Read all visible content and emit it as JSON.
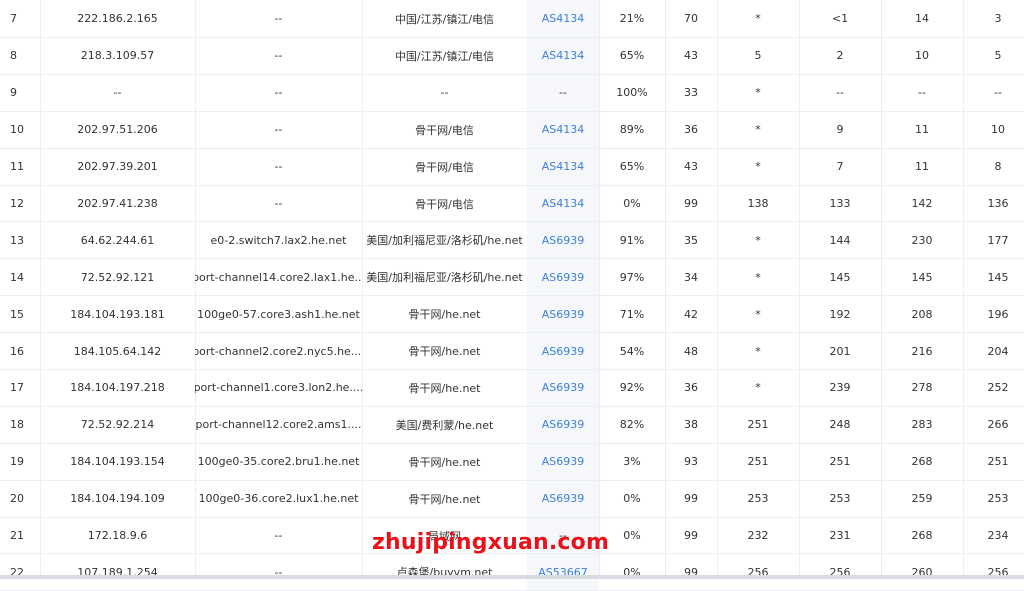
{
  "trace": {
    "rows": [
      {
        "hop": "7",
        "ip": "222.186.2.165",
        "host": "--",
        "location": "中国/江苏/镇江/电信",
        "as": "AS4134",
        "loss": "21%",
        "sent": "70",
        "last": "*",
        "avg": "<1",
        "best": "14",
        "worst": "3"
      },
      {
        "hop": "8",
        "ip": "218.3.109.57",
        "host": "--",
        "location": "中国/江苏/镇江/电信",
        "as": "AS4134",
        "loss": "65%",
        "sent": "43",
        "last": "5",
        "avg": "2",
        "best": "10",
        "worst": "5"
      },
      {
        "hop": "9",
        "ip": "--",
        "host": "--",
        "location": "--",
        "as": "--",
        "loss": "100%",
        "sent": "33",
        "last": "*",
        "avg": "--",
        "best": "--",
        "worst": "--"
      },
      {
        "hop": "10",
        "ip": "202.97.51.206",
        "host": "--",
        "location": "骨干网/电信",
        "as": "AS4134",
        "loss": "89%",
        "sent": "36",
        "last": "*",
        "avg": "9",
        "best": "11",
        "worst": "10"
      },
      {
        "hop": "11",
        "ip": "202.97.39.201",
        "host": "--",
        "location": "骨干网/电信",
        "as": "AS4134",
        "loss": "65%",
        "sent": "43",
        "last": "*",
        "avg": "7",
        "best": "11",
        "worst": "8"
      },
      {
        "hop": "12",
        "ip": "202.97.41.238",
        "host": "--",
        "location": "骨干网/电信",
        "as": "AS4134",
        "loss": "0%",
        "sent": "99",
        "last": "138",
        "avg": "133",
        "best": "142",
        "worst": "136"
      },
      {
        "hop": "13",
        "ip": "64.62.244.61",
        "host": "e0-2.switch7.lax2.he.net",
        "location": "美国/加利福尼亚/洛杉矶/he.net",
        "as": "AS6939",
        "loss": "91%",
        "sent": "35",
        "last": "*",
        "avg": "144",
        "best": "230",
        "worst": "177"
      },
      {
        "hop": "14",
        "ip": "72.52.92.121",
        "host": "port-channel14.core2.lax1.he...",
        "location": "美国/加利福尼亚/洛杉矶/he.net",
        "as": "AS6939",
        "loss": "97%",
        "sent": "34",
        "last": "*",
        "avg": "145",
        "best": "145",
        "worst": "145"
      },
      {
        "hop": "15",
        "ip": "184.104.193.181",
        "host": "100ge0-57.core3.ash1.he.net",
        "location": "骨干网/he.net",
        "as": "AS6939",
        "loss": "71%",
        "sent": "42",
        "last": "*",
        "avg": "192",
        "best": "208",
        "worst": "196"
      },
      {
        "hop": "16",
        "ip": "184.105.64.142",
        "host": "port-channel2.core2.nyc5.he....",
        "location": "骨干网/he.net",
        "as": "AS6939",
        "loss": "54%",
        "sent": "48",
        "last": "*",
        "avg": "201",
        "best": "216",
        "worst": "204"
      },
      {
        "hop": "17",
        "ip": "184.104.197.218",
        "host": "port-channel1.core3.lon2.he....",
        "location": "骨干网/he.net",
        "as": "AS6939",
        "loss": "92%",
        "sent": "36",
        "last": "*",
        "avg": "239",
        "best": "278",
        "worst": "252"
      },
      {
        "hop": "18",
        "ip": "72.52.92.214",
        "host": "port-channel12.core2.ams1....",
        "location": "美国/费利蒙/he.net",
        "as": "AS6939",
        "loss": "82%",
        "sent": "38",
        "last": "251",
        "avg": "248",
        "best": "283",
        "worst": "266"
      },
      {
        "hop": "19",
        "ip": "184.104.193.154",
        "host": "100ge0-35.core2.bru1.he.net",
        "location": "骨干网/he.net",
        "as": "AS6939",
        "loss": "3%",
        "sent": "93",
        "last": "251",
        "avg": "251",
        "best": "268",
        "worst": "251"
      },
      {
        "hop": "20",
        "ip": "184.104.194.109",
        "host": "100ge0-36.core2.lux1.he.net",
        "location": "骨干网/he.net",
        "as": "AS6939",
        "loss": "0%",
        "sent": "99",
        "last": "253",
        "avg": "253",
        "best": "259",
        "worst": "253"
      },
      {
        "hop": "21",
        "ip": "172.18.9.6",
        "host": "--",
        "location": "局域网",
        "as": "--",
        "loss": "0%",
        "sent": "99",
        "last": "232",
        "avg": "231",
        "best": "268",
        "worst": "234"
      },
      {
        "hop": "22",
        "ip": "107.189.1.254",
        "host": "--",
        "location": "卢森堡/buyvm.net",
        "as": "AS53667",
        "loss": "0%",
        "sent": "99",
        "last": "256",
        "avg": "256",
        "best": "260",
        "worst": "256"
      }
    ]
  },
  "watermark": {
    "text": "zhujipingxuan.com"
  },
  "colors": {
    "as_link": "#3d7fd8",
    "watermark": "#e8121a",
    "border": "#ebeef5",
    "as_column_bg": "#f5f7fa"
  }
}
